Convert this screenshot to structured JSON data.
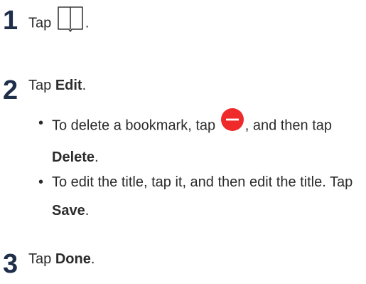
{
  "steps": [
    {
      "number": "1",
      "pre": "Tap",
      "icon": "book-icon",
      "post": "."
    },
    {
      "number": "2",
      "pre": "Tap ",
      "bold": "Edit",
      "post": ".",
      "bullets": [
        {
          "pre": "To delete a bookmark, tap",
          "icon": "minus-circle-icon",
          "mid": ", and then tap ",
          "bold": "Delete",
          "post": "."
        },
        {
          "pre": "To edit the title, tap it, and then edit the title. Tap ",
          "bold": "Save",
          "post": "."
        }
      ]
    },
    {
      "number": "3",
      "pre": "Tap ",
      "bold": "Done",
      "post": "."
    }
  ],
  "bullet_char": "•",
  "colors": {
    "text": "#2b2b2b",
    "step_number": "#1f2f4a",
    "delete_icon": "#ee2a2a"
  }
}
